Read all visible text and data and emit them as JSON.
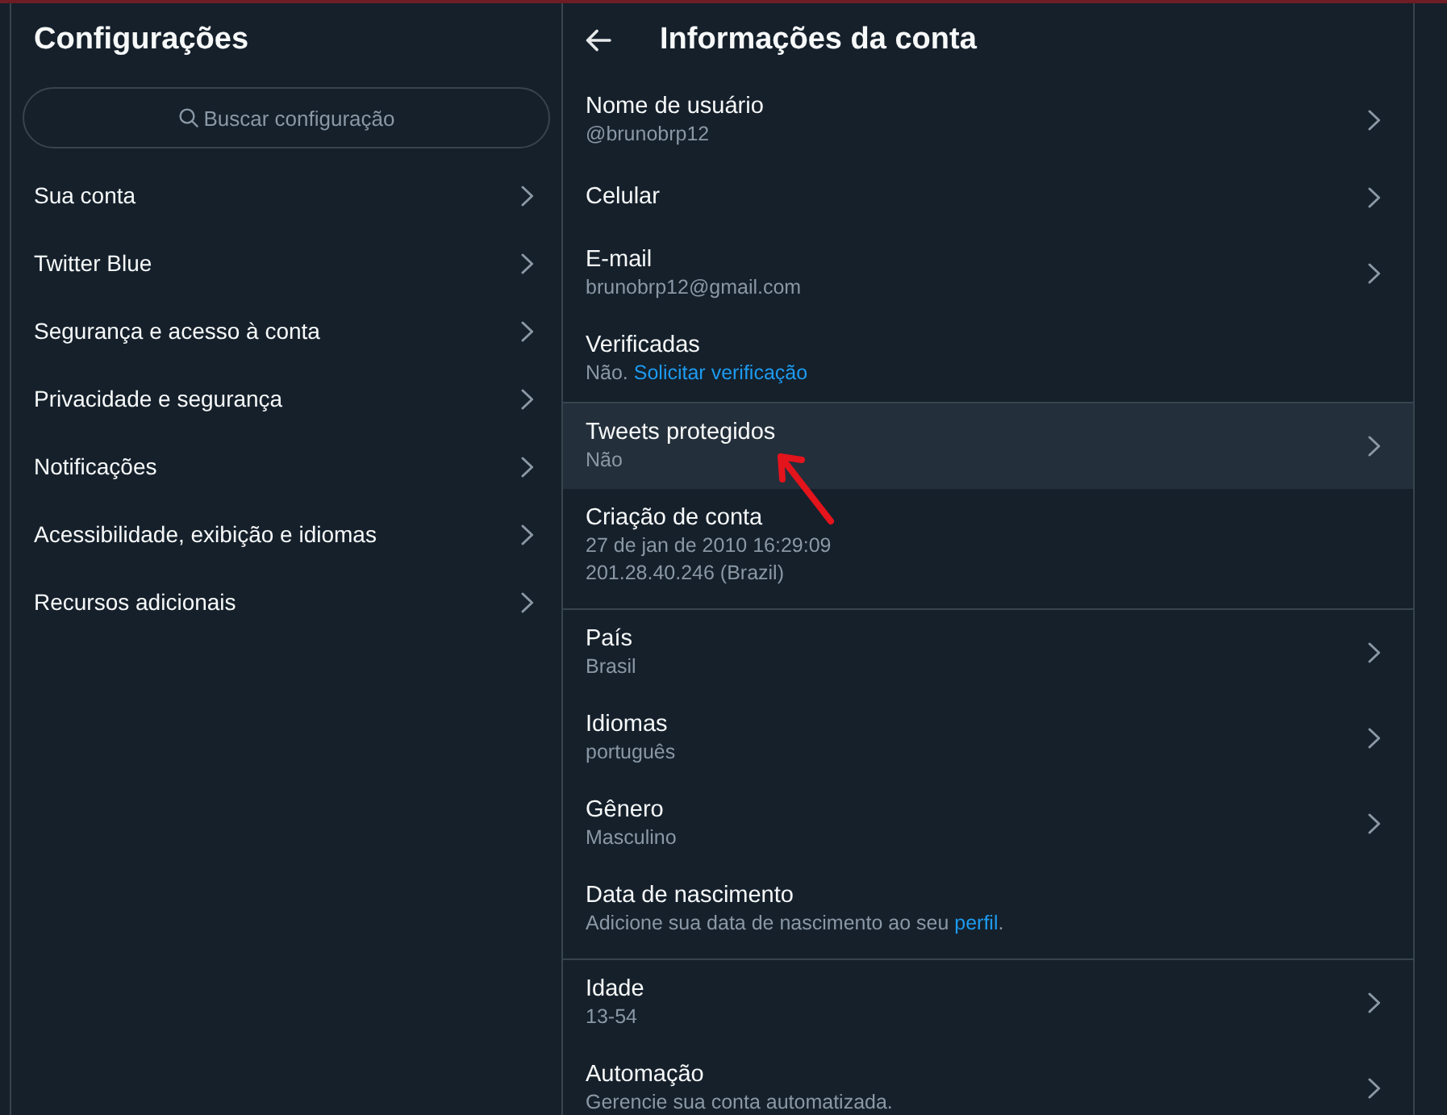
{
  "sidebar": {
    "title": "Configurações",
    "search": {
      "placeholder": "Buscar configuração"
    },
    "items": [
      {
        "label": "Sua conta"
      },
      {
        "label": "Twitter Blue"
      },
      {
        "label": "Segurança e acesso à conta"
      },
      {
        "label": "Privacidade e segurança"
      },
      {
        "label": "Notificações"
      },
      {
        "label": "Acessibilidade, exibição e idiomas"
      },
      {
        "label": "Recursos adicionais"
      }
    ]
  },
  "account": {
    "title": "Informações da conta",
    "sections": [
      {
        "items": [
          {
            "title": "Nome de usuário",
            "details": [
              [
                {
                  "kind": "text",
                  "text": "@brunobrp12"
                }
              ]
            ],
            "chevron": true,
            "hovered": false
          },
          {
            "title": "Celular",
            "chevron": true,
            "hovered": false
          },
          {
            "title": "E-mail",
            "details": [
              [
                {
                  "kind": "text",
                  "text": "brunobrp12@gmail.com"
                }
              ]
            ],
            "chevron": true,
            "hovered": false
          },
          {
            "title": "Verificadas",
            "details": [
              [
                {
                  "kind": "text",
                  "text": "Não. "
                },
                {
                  "kind": "link",
                  "text": "Solicitar verificação"
                }
              ]
            ],
            "chevron": false,
            "hovered": false
          }
        ]
      },
      {
        "items": [
          {
            "title": "Tweets protegidos",
            "details": [
              [
                {
                  "kind": "text",
                  "text": "Não"
                }
              ]
            ],
            "chevron": true,
            "hovered": true
          },
          {
            "title": "Criação de conta",
            "details": [
              [
                {
                  "kind": "text",
                  "text": "27 de jan de 2010 16:29:09"
                }
              ],
              [
                {
                  "kind": "text",
                  "text": "201.28.40.246 (Brazil)"
                }
              ]
            ],
            "chevron": false,
            "hovered": false
          }
        ]
      },
      {
        "items": [
          {
            "title": "País",
            "details": [
              [
                {
                  "kind": "text",
                  "text": "Brasil"
                }
              ]
            ],
            "chevron": true,
            "hovered": false
          },
          {
            "title": "Idiomas",
            "details": [
              [
                {
                  "kind": "text",
                  "text": "português"
                }
              ]
            ],
            "chevron": true,
            "hovered": false
          },
          {
            "title": "Gênero",
            "details": [
              [
                {
                  "kind": "text",
                  "text": "Masculino"
                }
              ]
            ],
            "chevron": true,
            "hovered": false
          },
          {
            "title": "Data de nascimento",
            "details": [
              [
                {
                  "kind": "text",
                  "text": "Adicione sua data de nascimento ao seu "
                },
                {
                  "kind": "link",
                  "text": "perfil"
                },
                {
                  "kind": "text",
                  "text": "."
                }
              ]
            ],
            "chevron": false,
            "hovered": false
          }
        ]
      },
      {
        "items": [
          {
            "title": "Idade",
            "details": [
              [
                {
                  "kind": "text",
                  "text": "13-54"
                }
              ]
            ],
            "chevron": true,
            "hovered": false
          },
          {
            "title": "Automação",
            "details": [
              [
                {
                  "kind": "text",
                  "text": "Gerencie sua conta automatizada."
                }
              ]
            ],
            "chevron": true,
            "hovered": false
          }
        ]
      }
    ]
  }
}
